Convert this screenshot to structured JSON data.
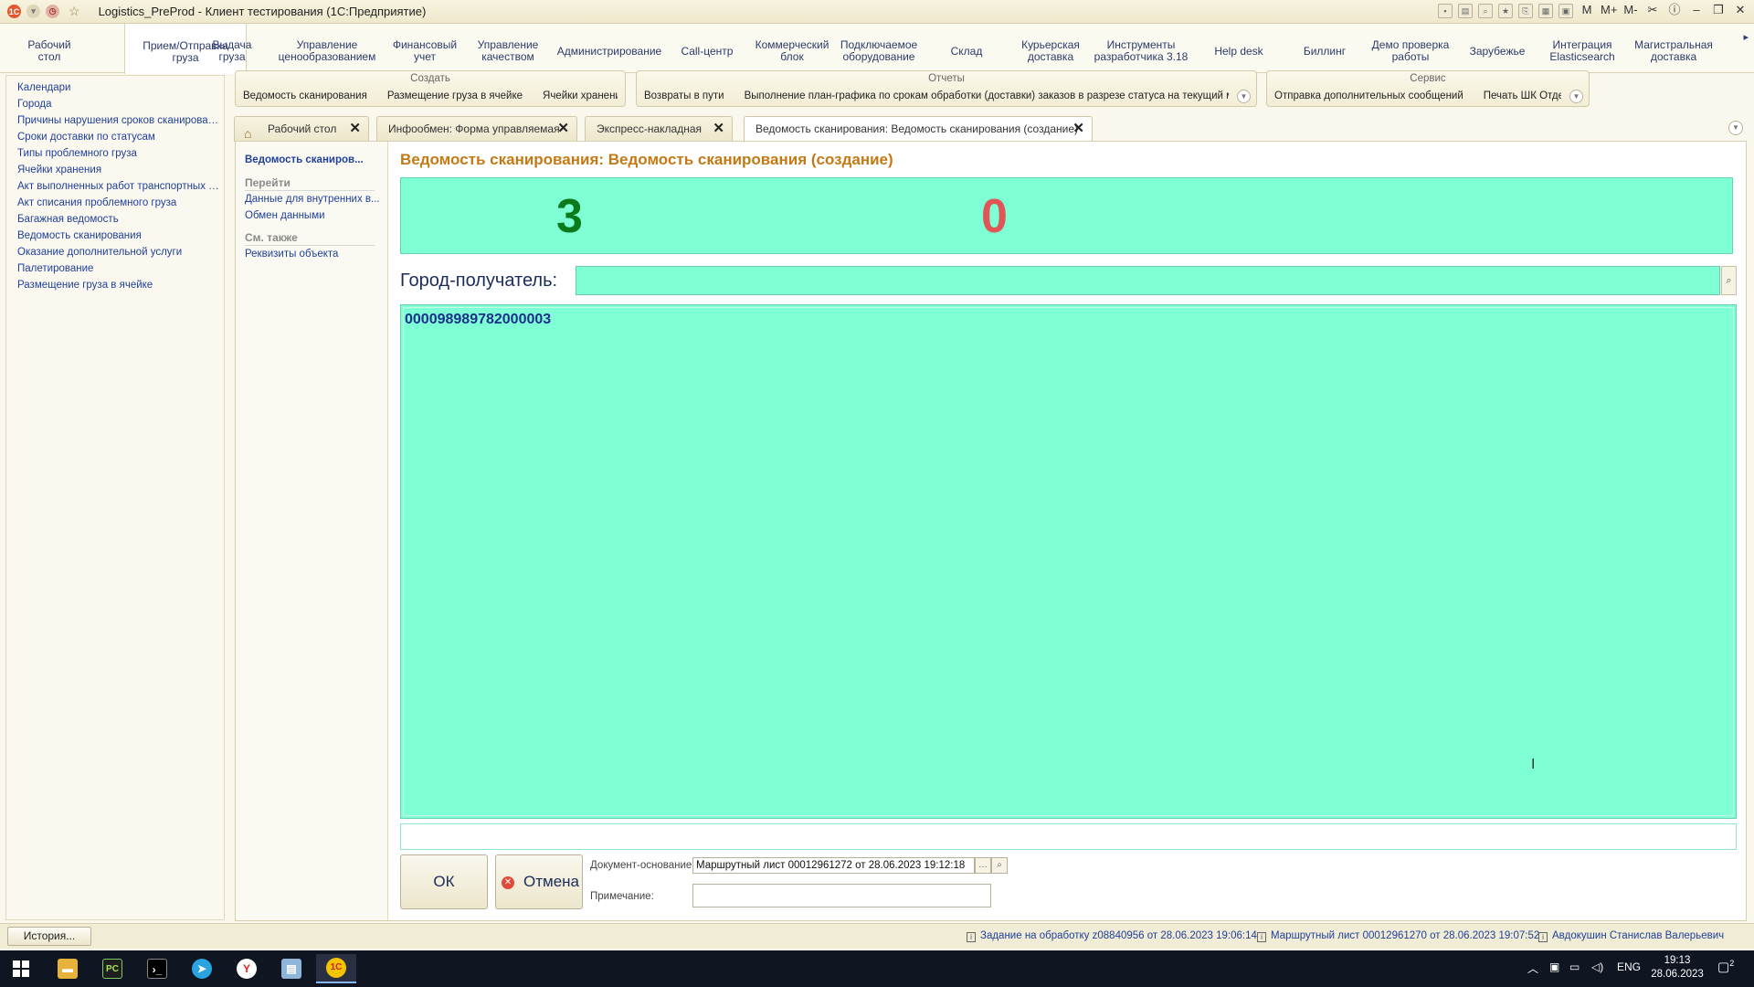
{
  "window": {
    "title": "Logistics_PreProd - Клиент тестирования (1С:Предприятие)"
  },
  "sections": [
    "Рабочий\nстол",
    "Прием/Отправка\nгруза",
    "Выдача\nгруза",
    "Управление\nценообразованием",
    "Финансовый\nучет",
    "Управление\nкачеством",
    "Администрирование",
    "Call-центр",
    "Коммерческий\nблок",
    "Подключаемое\nоборудование",
    "Склад",
    "Курьерская\nдоставка",
    "Инструменты\nразработчика 3.18",
    "Help desk",
    "Биллинг",
    "Демо проверка\nработы",
    "Зарубежье",
    "Интеграция\nElasticsearch",
    "Магистральная\nдоставка"
  ],
  "left_nav": [
    "Календари",
    "Города",
    "Причины нарушения сроков сканирован...",
    "Сроки доставки по статусам",
    "Типы проблемного груза",
    "Ячейки хранения",
    "Акт выполненных работ транспортных к...",
    "Акт списания проблемного груза",
    "Багажная ведомость",
    "Ведомость сканирования",
    "Оказание дополнительной услуги",
    "Палетирование",
    "Размещение груза в ячейке"
  ],
  "command_groups": {
    "create": {
      "title": "Создать",
      "items": [
        "Ведомость сканирования",
        "Размещение груза в ячейке",
        "Ячейки хранения"
      ]
    },
    "reports": {
      "title": "Отчеты",
      "items": [
        "Возвраты в пути",
        "Выполнение план-графика по срокам обработки (доставки) заказов в разрезе статуса  на текущий м..."
      ]
    },
    "service": {
      "title": "Сервис",
      "items": [
        "Отправка дополнительных сообщений",
        "Печать ШК Отде..."
      ]
    }
  },
  "tabs": [
    "Рабочий стол",
    "Инфообмен: Форма управляемая",
    "Экспресс-накладная",
    "Ведомость сканирования: Ведомость сканирования (создание)"
  ],
  "form_nav": {
    "current": "Ведомость сканиров...",
    "goto_header": "Перейти",
    "goto_items": [
      "Данные для внутренних в...",
      "Обмен данными"
    ],
    "see_also_header": "См. также",
    "see_also_items": [
      "Реквизиты объекта"
    ]
  },
  "form": {
    "title": "Ведомость сканирования: Ведомость сканирования (создание)",
    "count_scanned": "3",
    "count_errors": "0",
    "city_label": "Город-получатель:",
    "city_value": "",
    "scanned_code": "000098989782000003",
    "ok_label": "ОК",
    "cancel_label": "Отмена",
    "doc_basis_label": "Документ-основание:",
    "doc_basis_value": "Маршрутный лист 00012961272 от 28.06.2023 19:12:18",
    "note_label": "Примечание:",
    "note_value": ""
  },
  "status_bar": {
    "history": "История...",
    "items": [
      "Задание на обработку z08840956 от 28.06.2023 19:06:14",
      "Маршрутный лист 00012961270 от 28.06.2023 19:07:52",
      "Авдокушин Станислав Валерьевич"
    ]
  },
  "taskbar": {
    "lang": "ENG",
    "time": "19:13",
    "date": "28.06.2023",
    "notify_count": "2"
  },
  "colors": {
    "accent_green": "#7fffd4",
    "count_ok": "#0a7a1a",
    "count_err": "#e05555",
    "title": "#c47a14",
    "link": "#1f3f9a"
  }
}
